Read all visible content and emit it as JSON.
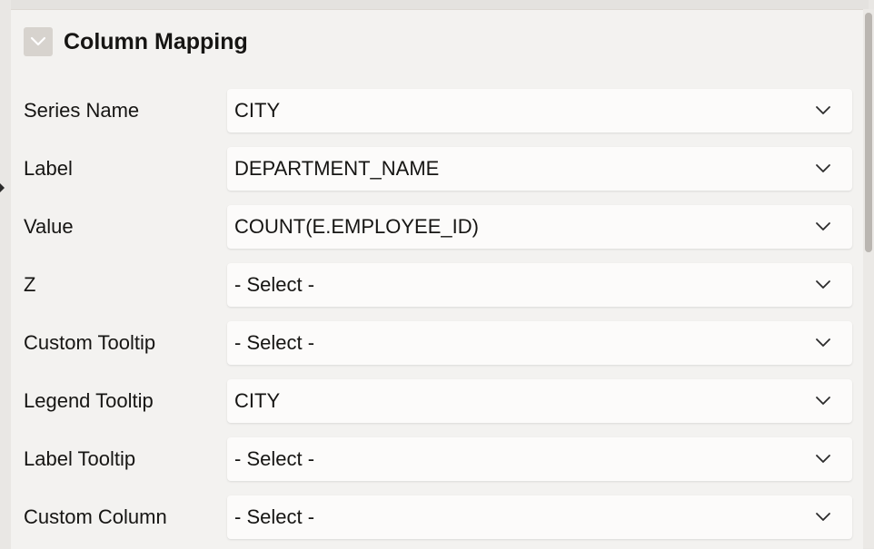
{
  "section": {
    "title": "Column Mapping",
    "collapse_icon": "chevron-down-icon"
  },
  "fields": [
    {
      "id": "series-name",
      "label": "Series Name",
      "value": "CITY"
    },
    {
      "id": "label",
      "label": "Label",
      "value": "DEPARTMENT_NAME"
    },
    {
      "id": "value",
      "label": "Value",
      "value": "COUNT(E.EMPLOYEE_ID)"
    },
    {
      "id": "z",
      "label": "Z",
      "value": "- Select -"
    },
    {
      "id": "custom-tooltip",
      "label": "Custom Tooltip",
      "value": "- Select -"
    },
    {
      "id": "legend-tooltip",
      "label": "Legend Tooltip",
      "value": "CITY"
    },
    {
      "id": "label-tooltip",
      "label": "Label Tooltip",
      "value": "- Select -"
    },
    {
      "id": "custom-column",
      "label": "Custom Column",
      "value": "- Select -"
    }
  ],
  "colors": {
    "text": "#161513",
    "panel": "#f3f2f0",
    "field": "#fcfbfa",
    "collapse_button": "#d7d3ce"
  }
}
